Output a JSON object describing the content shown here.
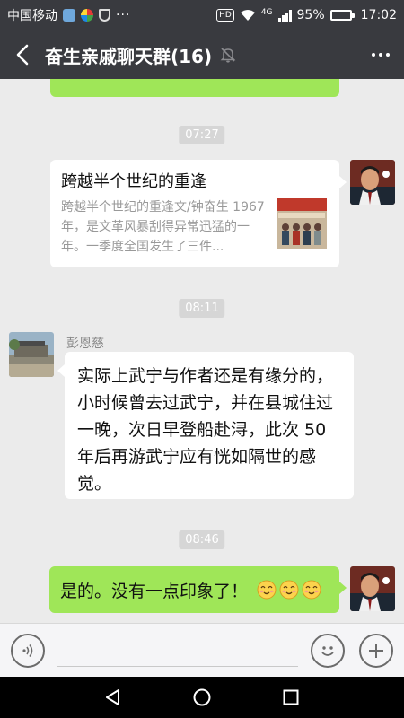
{
  "status_bar": {
    "carrier": "中国移动",
    "hd": "HD",
    "network": "4G",
    "battery_text": "95%",
    "battery_level": 0.95,
    "time": "17:02"
  },
  "header": {
    "title": "奋生亲戚聊天群(16)",
    "icons": [
      "back-arrow-icon",
      "mute-bell-icon",
      "more-icon"
    ]
  },
  "messages": {
    "time1": "07:27",
    "card": {
      "title": "跨越半个世纪的重逢",
      "description": "跨越半个世纪的重逢文/钟奋生 1967年，是文革风暴刮得异常迅猛的一年。一季度全国发生了三件..."
    },
    "time2": "08:11",
    "sender_name": "彭恩慈",
    "incoming_text": "实际上武宁与作者还是有缘分的，小时候曾去过武宁，并在县城住过一晚，次日早登船赴浔，此次 50 年后再游武宁应有恍如隔世的感觉。",
    "time3": "08:46",
    "outgoing_text": "是的。没有一点印象了！",
    "outgoing_emojis": [
      "smile-emoji",
      "smile-emoji",
      "smile-emoji"
    ]
  },
  "input_bar": {
    "value": "",
    "icons": [
      "voice-icon",
      "emoji-face-icon",
      "plus-icon"
    ]
  },
  "nav_bar": {
    "icons": [
      "back-triangle-icon",
      "home-circle-icon",
      "recents-square-icon"
    ]
  },
  "colors": {
    "topbar": "#393a3f",
    "chat_bg": "#ebebeb",
    "bubble_out": "#9fe658",
    "bubble_in": "#ffffff",
    "timestamp_bg": "#d6d6d6"
  }
}
